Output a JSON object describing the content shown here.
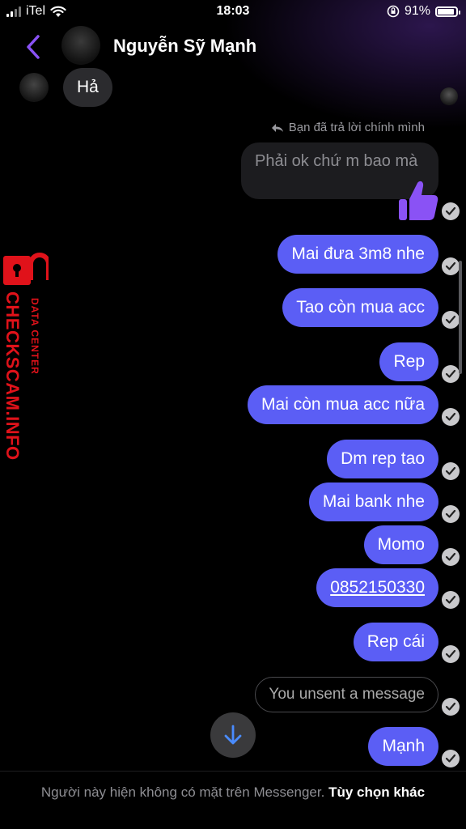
{
  "status_bar": {
    "carrier": "iTel",
    "time": "18:03",
    "battery": "91%"
  },
  "header": {
    "contact_name": "Nguyễn Sỹ Mạnh"
  },
  "messages": {
    "incoming_1": "Hả",
    "reply_label": "Bạn đã trả lời chính mình",
    "reply_quote": "Phải ok chứ m bao mà",
    "out_1": "Mai đưa 3m8 nhe",
    "out_2": "Tao còn mua acc",
    "out_3": "Rep",
    "out_4": "Mai còn mua acc nữa",
    "out_5": "Dm rep tao",
    "out_6": "Mai bank nhe",
    "out_7": "Momo",
    "out_8": "0852150330",
    "out_9": "Rep cái",
    "unsent": "You unsent a message",
    "out_10": "Mạnh"
  },
  "watermark": {
    "main": "CHECKSCAM.INFO",
    "sub": "DATA CENTER"
  },
  "footer": {
    "notice": "Người này hiện không có mặt trên Messenger.",
    "option": "Tùy chọn khác"
  },
  "colors": {
    "outgoing_bubble": "#5b5ef5",
    "accent": "#8a52f5",
    "watermark": "#e0121a"
  }
}
